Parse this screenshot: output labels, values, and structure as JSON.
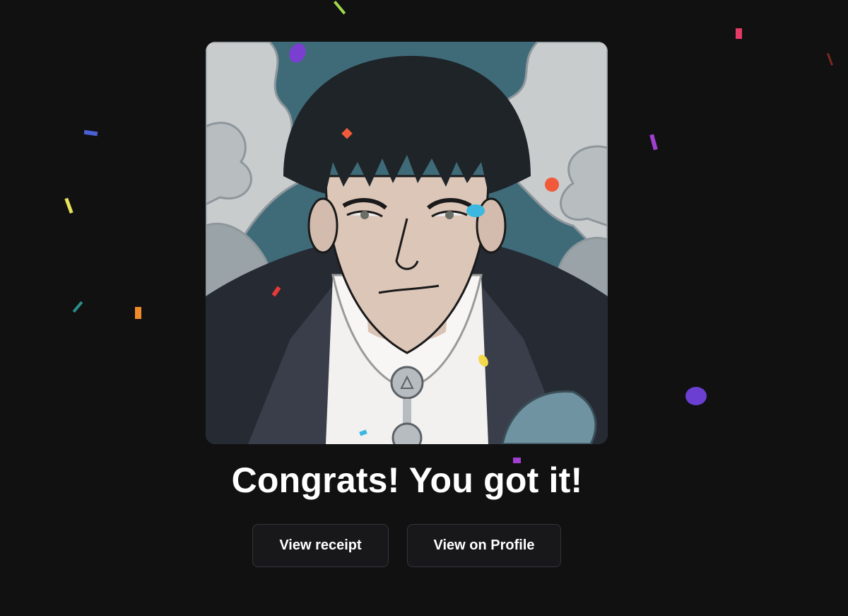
{
  "artwork": {
    "description_icon": "nft-portrait-image"
  },
  "headline": "Congrats! You got it!",
  "actions": {
    "view_receipt_label": "View receipt",
    "view_profile_label": "View on Profile"
  },
  "theme": {
    "background": "#111112",
    "button_background": "#18181b",
    "button_border": "#33343a",
    "text": "#ffffff"
  },
  "confetti_colors": [
    "#e53a66",
    "#4b5fd6",
    "#e6e35a",
    "#2a8f8a",
    "#f08a2a",
    "#a13fd1",
    "#6a3fd1",
    "#f05a3a",
    "#3ab8e0",
    "#f2d84a",
    "#a0d84a"
  ]
}
